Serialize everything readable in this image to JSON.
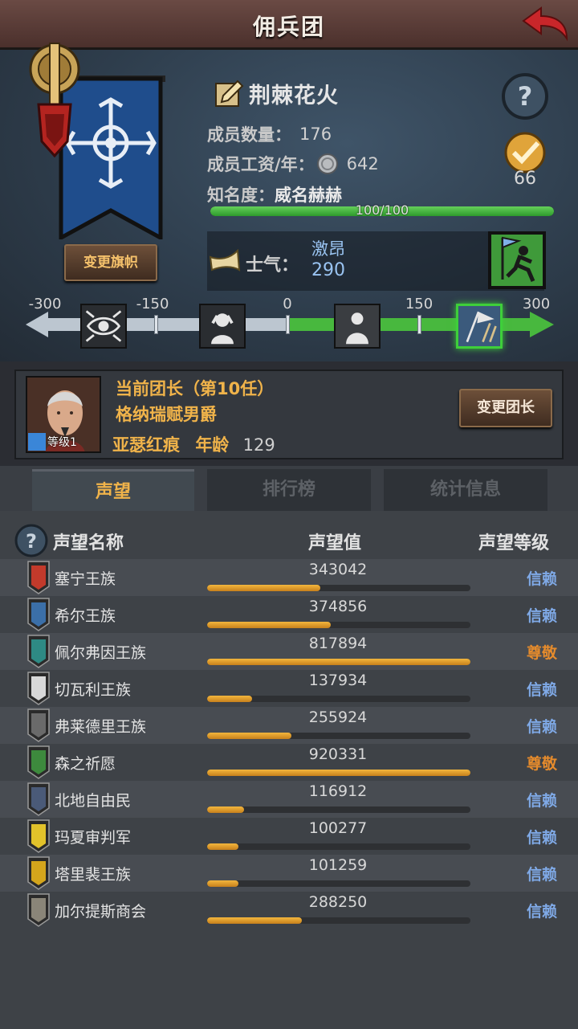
{
  "header": {
    "title": "佣兵团"
  },
  "guild": {
    "name": "荆棘花火",
    "members_label": "成员数量：",
    "members_value": "176",
    "salary_label": "成员工资/年：",
    "salary_value": "642",
    "fame_label": "知名度：",
    "fame_value": "威名赫赫",
    "fame_bar_text": "100/100",
    "fame_progress": 1.0,
    "badge_value": "66",
    "change_banner_label": "变更旗帜"
  },
  "morale": {
    "label": "士气：",
    "state": "激昂",
    "value": "290",
    "scale_labels": [
      "-300",
      "-150",
      "0",
      "150",
      "300"
    ],
    "scale_min": -300,
    "scale_max": 300,
    "states": [
      {
        "icon": "eye-icon",
        "active": false
      },
      {
        "icon": "despair-icon",
        "active": false
      },
      {
        "icon": "neutral-icon",
        "active": false
      },
      {
        "icon": "flag-icon",
        "active": true
      }
    ]
  },
  "leader": {
    "title": "当前团长（第10任）",
    "name": "格纳瑞赋男爵",
    "level_label": "等级1",
    "origin": "亚瑟红痕",
    "age_label": "年龄",
    "age_value": "129",
    "change_leader_label": "变更团长"
  },
  "tabs": [
    {
      "label": "声望",
      "active": true
    },
    {
      "label": "排行榜",
      "active": false
    },
    {
      "label": "统计信息",
      "active": false
    }
  ],
  "reputation": {
    "col_name": "声望名称",
    "col_value": "声望值",
    "col_level": "声望等级",
    "rows": [
      {
        "name": "塞宁王族",
        "value": "343042",
        "progress": 0.43,
        "level": "信赖",
        "tier": "trust",
        "icon_color": "#c23a2b"
      },
      {
        "name": "希尔王族",
        "value": "374856",
        "progress": 0.47,
        "level": "信赖",
        "tier": "trust",
        "icon_color": "#3b6fa8"
      },
      {
        "name": "佩尔弗因王族",
        "value": "817894",
        "progress": 1.0,
        "level": "尊敬",
        "tier": "respect",
        "icon_color": "#2e8a84"
      },
      {
        "name": "切瓦利王族",
        "value": "137934",
        "progress": 0.17,
        "level": "信赖",
        "tier": "trust",
        "icon_color": "#d8d8d8"
      },
      {
        "name": "弗莱德里王族",
        "value": "255924",
        "progress": 0.32,
        "level": "信赖",
        "tier": "trust",
        "icon_color": "#6a6a6a"
      },
      {
        "name": "森之祈愿",
        "value": "920331",
        "progress": 1.0,
        "level": "尊敬",
        "tier": "respect",
        "icon_color": "#3d8a3d"
      },
      {
        "name": "北地自由民",
        "value": "116912",
        "progress": 0.14,
        "level": "信赖",
        "tier": "trust",
        "icon_color": "#4a5a78"
      },
      {
        "name": "玛夏审判军",
        "value": "100277",
        "progress": 0.12,
        "level": "信赖",
        "tier": "trust",
        "icon_color": "#e2c22a"
      },
      {
        "name": "塔里裴王族",
        "value": "101259",
        "progress": 0.12,
        "level": "信赖",
        "tier": "trust",
        "icon_color": "#d4a51c"
      },
      {
        "name": "加尔提斯商会",
        "value": "288250",
        "progress": 0.36,
        "level": "信赖",
        "tier": "trust",
        "icon_color": "#8a8578"
      }
    ]
  }
}
